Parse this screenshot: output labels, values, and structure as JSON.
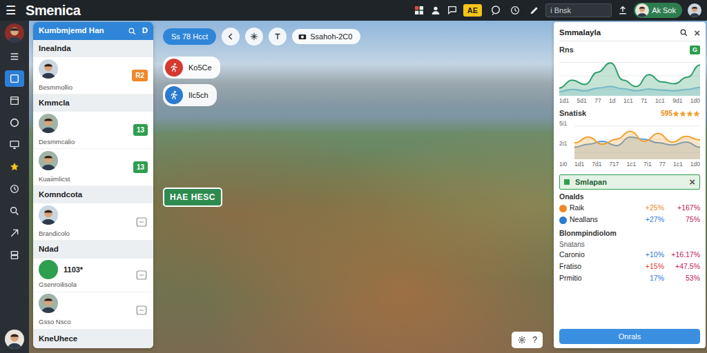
{
  "app": {
    "menu": "☰",
    "title": "Smenica"
  },
  "topbar": {
    "badge": "AE",
    "search": {
      "placeholder": "i Bnsk"
    },
    "user": "Ak Sok"
  },
  "rail": {
    "items": [
      {
        "selected": false
      },
      {
        "selected": true
      },
      {
        "selected": false
      },
      {
        "selected": false
      },
      {
        "selected": false
      },
      {
        "selected": false
      },
      {
        "selected": false
      },
      {
        "selected": false
      },
      {
        "selected": false
      },
      {
        "selected": false
      }
    ]
  },
  "contacts": {
    "title": "Kumbmjemd Han",
    "action": "D",
    "groups": [
      {
        "header": "Inealnda",
        "items": [
          {
            "kind": "avatar",
            "text": "Besmmollio",
            "badge": {
              "kind": "count",
              "text": "R2",
              "color": "#f0882a"
            }
          }
        ]
      },
      {
        "header": "Kmmcla",
        "items": [
          {
            "kind": "avatar",
            "text": "Desmmcalio",
            "badge": {
              "kind": "count",
              "text": "13",
              "color": "#2e9e4f"
            }
          },
          {
            "kind": "avatar",
            "text": "Kuaiimlicst",
            "badge": {
              "kind": "count",
              "text": "13",
              "color": "#2e9e4f"
            }
          }
        ]
      },
      {
        "header": "Komndcota",
        "items": [
          {
            "kind": "avatar",
            "text": "Brandicolo",
            "badge": {
              "kind": "icon"
            }
          }
        ]
      },
      {
        "header": "Ndad",
        "items": [
          {
            "kind": "number",
            "label": "1103*",
            "text": "Gsenroilisola",
            "badge": {
              "kind": "icon"
            }
          },
          {
            "kind": "avatar",
            "text": "Gsso Nsco",
            "badge": {
              "kind": "icon"
            }
          }
        ]
      }
    ],
    "footer": "KneUhece"
  },
  "map": {
    "pill": "Ss 78 Hcct",
    "search_chip": "Ssahoh-2C0",
    "chips": [
      {
        "text": "Ko5Ce",
        "color": "#d63a2f"
      },
      {
        "text": "Ilc5ch",
        "color": "#2b7bd0"
      }
    ],
    "label": "HAE HESC",
    "help": "?"
  },
  "stats": {
    "title": "Smmalayla",
    "close": "×",
    "charts": [
      {
        "title": "Rns",
        "badge": "G",
        "y_ticks": [],
        "x_ticks": [
          "1d1",
          "5d1",
          "77",
          "1d",
          "1c1",
          "71",
          "1c1",
          "9d1",
          "1d0"
        ],
        "series": [
          {
            "color": "#8fc3e8",
            "values": [
              8,
              14,
              10,
              18,
              22,
              16,
              10,
              15,
              12,
              10,
              14,
              20
            ]
          },
          {
            "color": "#2e9e6a",
            "values": [
              18,
              40,
              28,
              62,
              88,
              40,
              22,
              55,
              35,
              30,
              48,
              82
            ]
          }
        ]
      },
      {
        "title": "Snatisk",
        "rating": "595",
        "stars": 4,
        "y_ticks": [
          "5i1",
          "2i1",
          "1i0"
        ],
        "x_ticks": [
          "1d1",
          "7d1",
          "717",
          "1c1",
          "7i1",
          "77",
          "1c1",
          "1d0"
        ],
        "series": [
          {
            "color": "#5b9bd5",
            "values": [
              30,
              38,
              46,
              34,
              58,
              52,
              42,
              36,
              44,
              30
            ]
          },
          {
            "color": "#f0a030",
            "values": [
              42,
              58,
              38,
              52,
              74,
              46,
              68,
              44,
              60,
              50
            ]
          }
        ]
      }
    ],
    "strip": {
      "title": "Smlapan",
      "close": "×"
    },
    "sections": [
      {
        "header": "Onalds",
        "subheader": "",
        "rows": [
          {
            "kind": "dot",
            "name": "Raik",
            "a": "+25%",
            "b": "+167%",
            "color": "#f0882a"
          },
          {
            "kind": "dot",
            "name": "Neallans",
            "a": "+27%",
            "b": "75%",
            "color": "#2b7bd0"
          }
        ]
      },
      {
        "header": "Blonmpindiolom",
        "subheader": "Snatans",
        "rows": [
          {
            "kind": "plain",
            "name": "Caronio",
            "a": "+10%",
            "b": "+16.17%",
            "color": "#2b7bd0"
          },
          {
            "kind": "plain",
            "name": "Fratiso",
            "a": "+15%",
            "b": "+47.5%",
            "color": "#d63a2f"
          },
          {
            "kind": "plain",
            "name": "Prmitio",
            "a": "17%",
            "b": "53%",
            "color": "#2b7bd0"
          }
        ]
      }
    ],
    "button": "Onrals"
  }
}
